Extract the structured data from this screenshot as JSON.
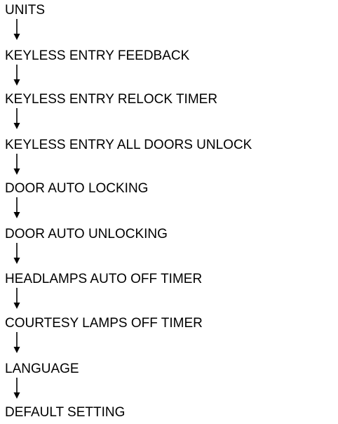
{
  "flowchart": {
    "steps": [
      {
        "label": "UNITS"
      },
      {
        "label": "KEYLESS ENTRY FEEDBACK"
      },
      {
        "label": "KEYLESS ENTRY RELOCK TIMER"
      },
      {
        "label": "KEYLESS ENTRY ALL DOORS UNLOCK"
      },
      {
        "label": "DOOR AUTO LOCKING"
      },
      {
        "label": "DOOR AUTO UNLOCKING"
      },
      {
        "label": "HEADLAMPS AUTO OFF TIMER"
      },
      {
        "label": "COURTESY LAMPS OFF TIMER"
      },
      {
        "label": "LANGUAGE"
      },
      {
        "label": "DEFAULT SETTING"
      }
    ]
  },
  "colors": {
    "text": "#000000",
    "arrow": "#000000",
    "background": "#ffffff"
  },
  "icons": {
    "connector": "down-arrow-icon"
  }
}
